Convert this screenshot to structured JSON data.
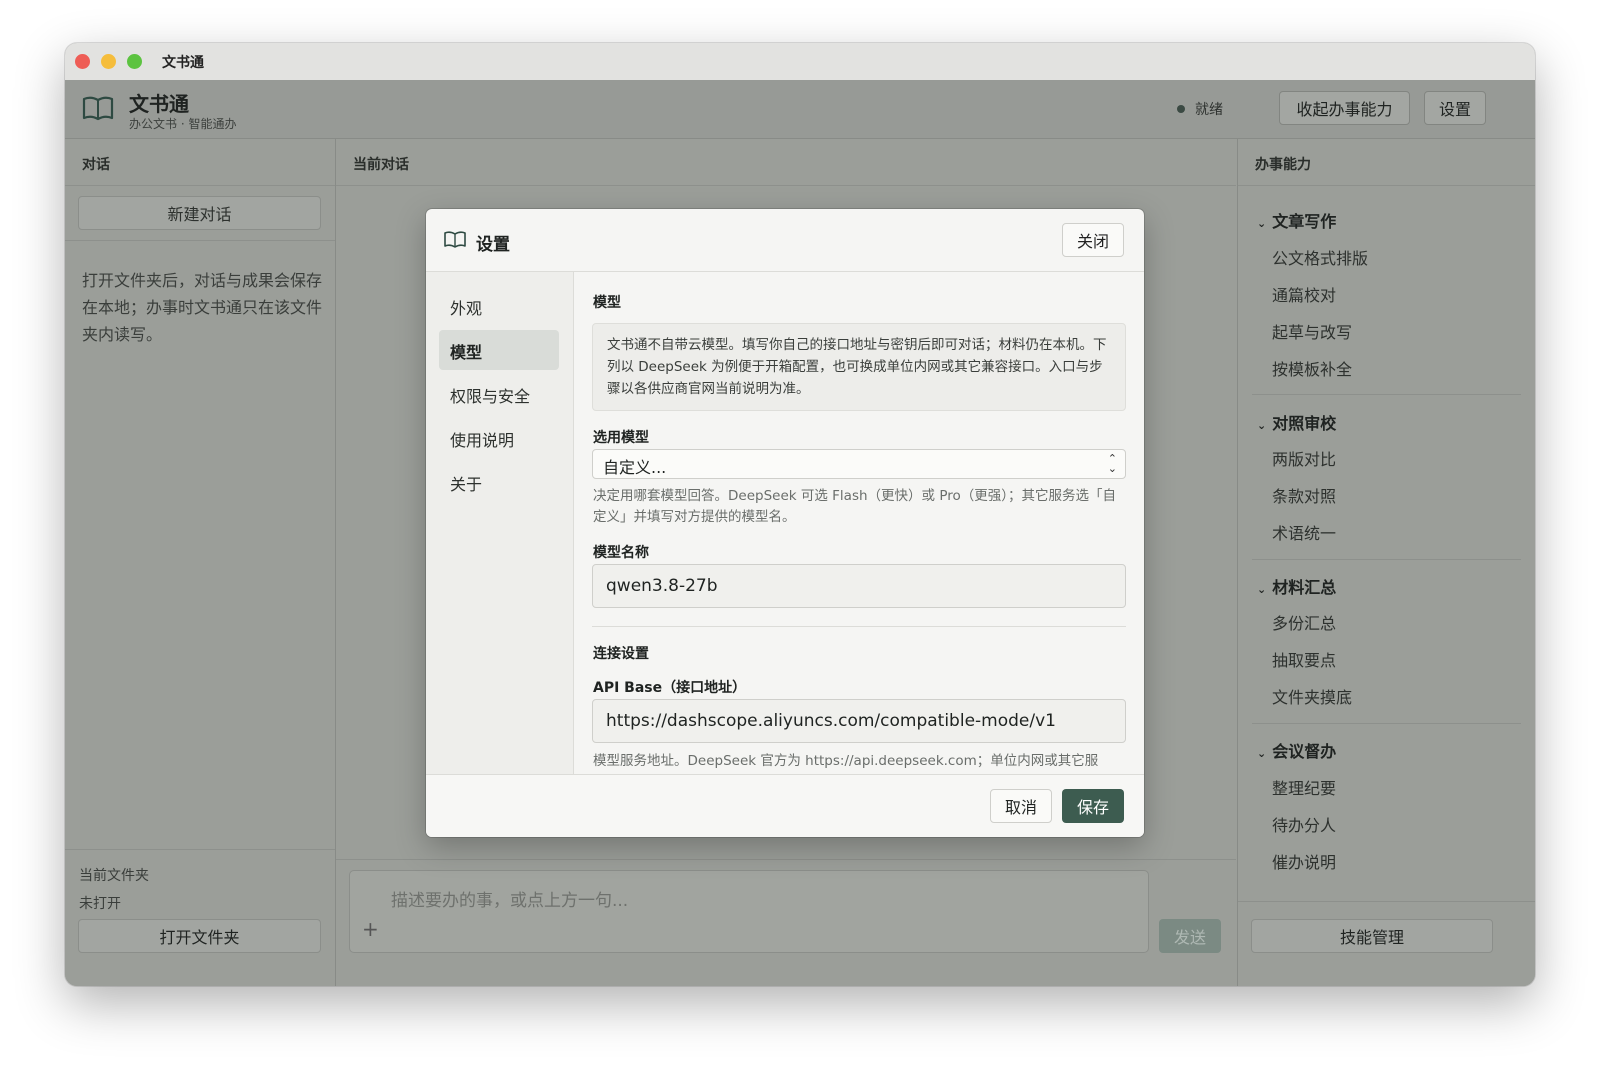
{
  "window": {
    "title": "文书通"
  },
  "header": {
    "app_name": "文书通",
    "app_subtitle": "办公文书 · 智能通办",
    "status": "就绪",
    "collapse_button": "收起办事能力",
    "settings_button": "设置"
  },
  "left": {
    "title": "对话",
    "new_chat": "新建对话",
    "description": "打开文件夹后，对话与成果会保存在本地；办事时文书通只在该文件夹内读写。",
    "folder_label": "当前文件夹",
    "folder_value": "未打开",
    "open_folder": "打开文件夹"
  },
  "middle": {
    "title": "当前对话",
    "composer_placeholder": "描述要办的事，或点上方一句...",
    "add_symbol": "+",
    "send": "发送"
  },
  "right": {
    "title": "办事能力",
    "groups": [
      {
        "title": "文章写作",
        "items": [
          "公文格式排版",
          "通篇校对",
          "起草与改写",
          "按模板补全"
        ]
      },
      {
        "title": "对照审校",
        "items": [
          "两版对比",
          "条款对照",
          "术语统一"
        ]
      },
      {
        "title": "材料汇总",
        "items": [
          "多份汇总",
          "抽取要点",
          "文件夹摸底"
        ]
      },
      {
        "title": "会议督办",
        "items": [
          "整理纪要",
          "待办分人",
          "催办说明"
        ]
      }
    ],
    "manage": "技能管理"
  },
  "modal": {
    "title": "设置",
    "close": "关闭",
    "nav": [
      "外观",
      "模型",
      "权限与安全",
      "使用说明",
      "关于"
    ],
    "active_nav": "模型",
    "section_title": "模型",
    "info": "文书通不自带云模型。填写你自己的接口地址与密钥后即可对话；材料仍在本机。下列以 DeepSeek 为例便于开箱配置，也可换成单位内网或其它兼容接口。入口与步骤以各供应商官网当前说明为准。",
    "model_select_label": "选用模型",
    "model_select_value": "自定义...",
    "model_select_help": "决定用哪套模型回答。DeepSeek 可选 Flash（更快）或 Pro（更强）；其它服务选「自定义」并填写对方提供的模型名。",
    "model_name_label": "模型名称",
    "model_name_value": "qwen3.8-27b",
    "connection_title": "连接设置",
    "api_base_label": "API Base（接口地址）",
    "api_base_value": "https://dashscope.aliyuncs.com/compatible-mode/v1",
    "api_base_help": "模型服务地址。DeepSeek 官方为 https://api.deepseek.com；单位内网或其它服",
    "cancel": "取消",
    "save": "保存"
  }
}
